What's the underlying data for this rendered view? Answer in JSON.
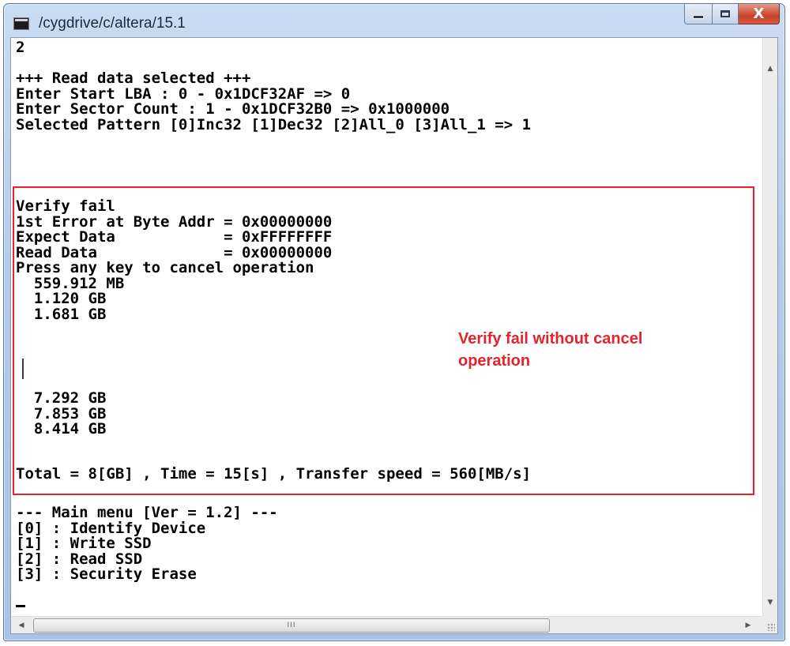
{
  "window": {
    "title": "/cygdrive/c/altera/15.1",
    "minimize_glyph": "",
    "maximize_glyph": "",
    "close_glyph": "X"
  },
  "terminal": {
    "lines": [
      "2",
      "",
      "+++ Read data selected +++",
      "Enter Start LBA : 0 - 0x1DCF32AF => 0",
      "Enter Sector Count : 1 - 0x1DCF32B0 => 0x1000000",
      "Selected Pattern [0]Inc32 [1]Dec32 [2]All_0 [3]All_1 => 1",
      "",
      "Verify fail",
      "1st Error at Byte Addr = 0x00000000",
      "Expect Data            = 0xFFFFFFFF",
      "Read Data              = 0x00000000",
      "Press any key to cancel operation",
      "  559.912 MB",
      "  1.120 GB",
      "  1.681 GB",
      "",
      "",
      "  7.292 GB",
      "  7.853 GB",
      "  8.414 GB",
      "",
      "Total = 8[GB] , Time = 15[s] , Transfer speed = 560[MB/s]",
      "",
      "--- Main menu [Ver = 1.2] ---",
      "[0] : Identify Device",
      "[1] : Write SSD",
      "[2] : Read SSD",
      "[3] : Security Erase"
    ]
  },
  "annotation": {
    "text": "Verify fail without cancel operation",
    "color": "#e4242c"
  },
  "scrollbars": {
    "up_arrow": "▲",
    "down_arrow": "▼",
    "left_arrow": "◀",
    "right_arrow": "▶",
    "thumb_grip": "III"
  }
}
